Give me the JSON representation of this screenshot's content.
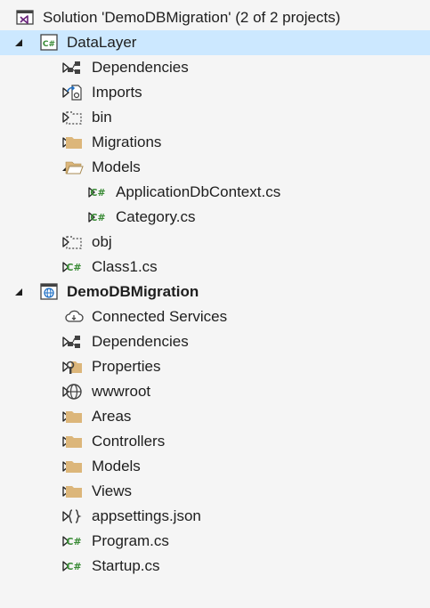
{
  "solution_explorer": {
    "items": [
      {
        "level": 0,
        "expander": "none",
        "icon": "solution-icon",
        "label": "Solution 'DemoDBMigration' (2 of 2 projects)",
        "bold": false,
        "selected": false
      },
      {
        "level": 0,
        "expander": "expanded",
        "icon": "csharp-project-icon",
        "label": "DataLayer",
        "bold": false,
        "selected": true
      },
      {
        "level": 1,
        "expander": "collapsed",
        "icon": "dependencies-icon",
        "label": "Dependencies",
        "bold": false,
        "selected": false
      },
      {
        "level": 1,
        "expander": "collapsed",
        "icon": "imports-icon",
        "label": "Imports",
        "bold": false,
        "selected": false
      },
      {
        "level": 1,
        "expander": "collapsed",
        "icon": "hidden-folder-icon",
        "label": "bin",
        "bold": false,
        "selected": false
      },
      {
        "level": 1,
        "expander": "collapsed",
        "icon": "folder-icon",
        "label": "Migrations",
        "bold": false,
        "selected": false
      },
      {
        "level": 1,
        "expander": "expanded",
        "icon": "open-folder-icon",
        "label": "Models",
        "bold": false,
        "selected": false
      },
      {
        "level": 2,
        "expander": "collapsed",
        "icon": "csharp-file-icon",
        "label": "ApplicationDbContext.cs",
        "bold": false,
        "selected": false
      },
      {
        "level": 2,
        "expander": "collapsed",
        "icon": "csharp-file-icon",
        "label": "Category.cs",
        "bold": false,
        "selected": false
      },
      {
        "level": 1,
        "expander": "collapsed",
        "icon": "hidden-folder-icon",
        "label": "obj",
        "bold": false,
        "selected": false
      },
      {
        "level": 1,
        "expander": "collapsed",
        "icon": "csharp-file-icon",
        "label": "Class1.cs",
        "bold": false,
        "selected": false
      },
      {
        "level": 0,
        "expander": "expanded",
        "icon": "web-project-icon",
        "label": "DemoDBMigration",
        "bold": true,
        "selected": false
      },
      {
        "level": 1,
        "expander": "none",
        "icon": "connected-services-icon",
        "label": "Connected Services",
        "bold": false,
        "selected": false
      },
      {
        "level": 1,
        "expander": "collapsed",
        "icon": "dependencies-icon",
        "label": "Dependencies",
        "bold": false,
        "selected": false
      },
      {
        "level": 1,
        "expander": "collapsed",
        "icon": "properties-icon",
        "label": "Properties",
        "bold": false,
        "selected": false
      },
      {
        "level": 1,
        "expander": "collapsed",
        "icon": "globe-icon",
        "label": "wwwroot",
        "bold": false,
        "selected": false
      },
      {
        "level": 1,
        "expander": "collapsed",
        "icon": "folder-icon",
        "label": "Areas",
        "bold": false,
        "selected": false
      },
      {
        "level": 1,
        "expander": "collapsed",
        "icon": "folder-icon",
        "label": "Controllers",
        "bold": false,
        "selected": false
      },
      {
        "level": 1,
        "expander": "collapsed",
        "icon": "folder-icon",
        "label": "Models",
        "bold": false,
        "selected": false
      },
      {
        "level": 1,
        "expander": "collapsed",
        "icon": "folder-icon",
        "label": "Views",
        "bold": false,
        "selected": false
      },
      {
        "level": 1,
        "expander": "collapsed",
        "icon": "json-file-icon",
        "label": "appsettings.json",
        "bold": false,
        "selected": false
      },
      {
        "level": 1,
        "expander": "collapsed",
        "icon": "csharp-file-icon",
        "label": "Program.cs",
        "bold": false,
        "selected": false
      },
      {
        "level": 1,
        "expander": "collapsed",
        "icon": "csharp-file-icon",
        "label": "Startup.cs",
        "bold": false,
        "selected": false
      }
    ]
  },
  "colors": {
    "background": "#f5f5f5",
    "selection": "#cce8ff",
    "text": "#1e1e1e",
    "folder": "#dcb67a",
    "csharp_green": "#388a34",
    "vs_purple": "#68217a"
  }
}
